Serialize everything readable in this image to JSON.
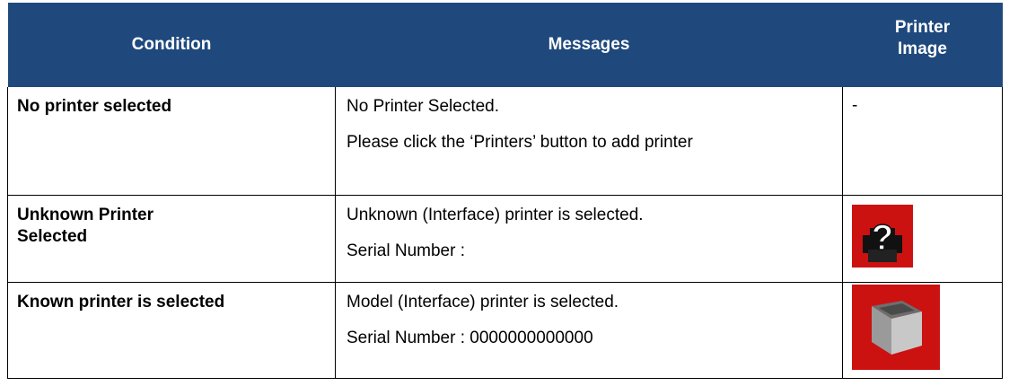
{
  "headers": {
    "condition": "Condition",
    "messages": "Messages",
    "printer_image": "Printer Image"
  },
  "rows": [
    {
      "condition": "No printer selected",
      "messages": [
        "No Printer Selected.",
        "Please click the ‘Printers’ button to add printer"
      ],
      "image_text": "-",
      "image_icon": "none"
    },
    {
      "condition": "Unknown Printer Selected",
      "messages": [
        "Unknown (Interface) printer is selected.",
        "Serial Number :"
      ],
      "image_icon": "unknown-printer-icon"
    },
    {
      "condition": "Known printer is selected",
      "messages": [
        "Model (Interface) printer is selected.",
        "Serial Number : 0000000000000"
      ],
      "image_icon": "known-printer-icon"
    }
  ],
  "colors": {
    "header_bg": "#1f497d",
    "header_text": "#ffffff",
    "icon_bg": "#cc1111"
  }
}
